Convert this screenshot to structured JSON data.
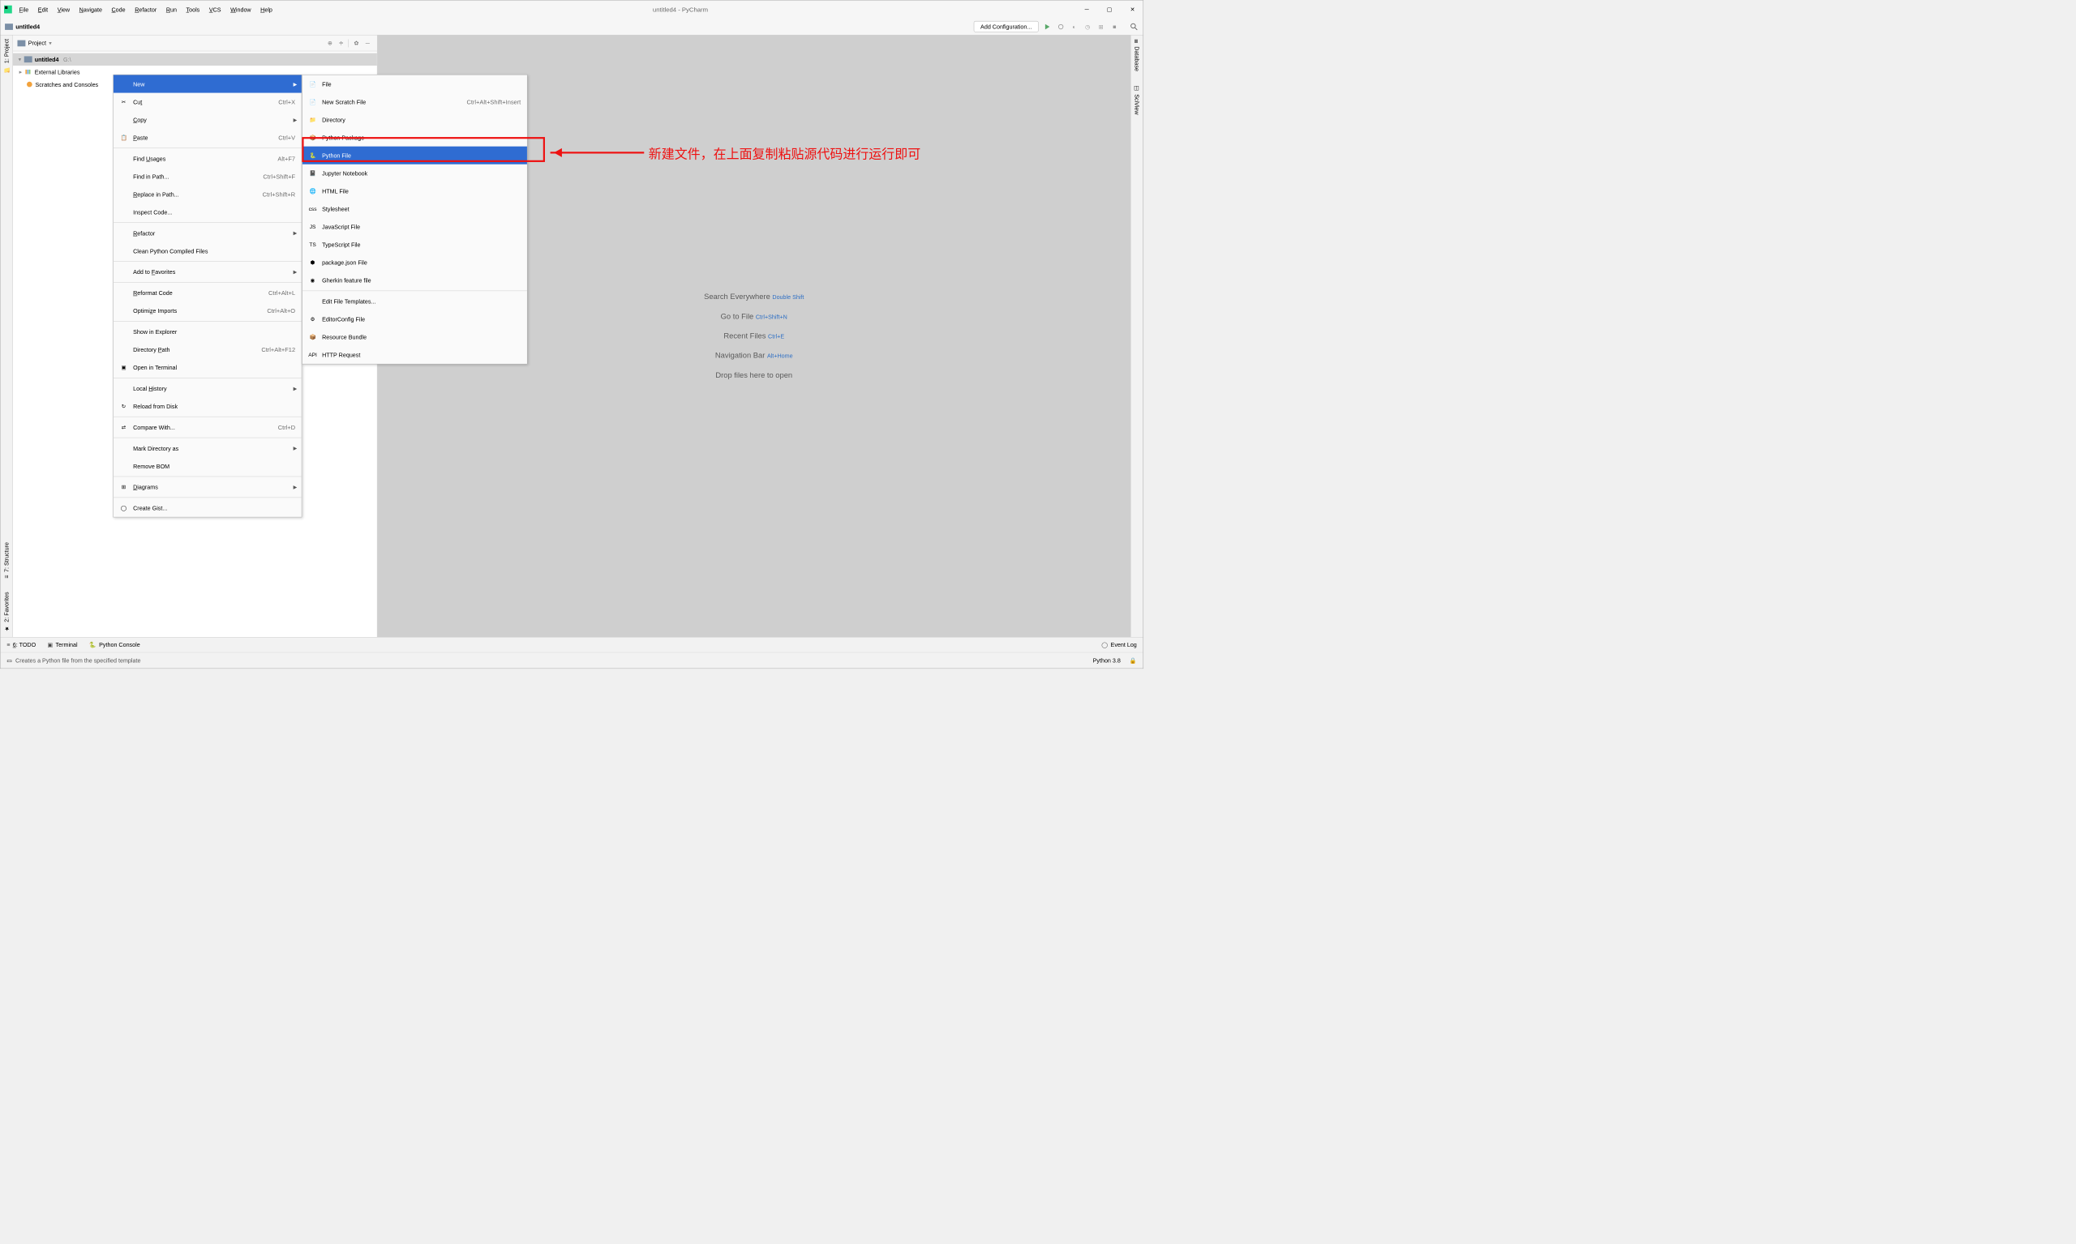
{
  "menubar": [
    "File",
    "Edit",
    "View",
    "Navigate",
    "Code",
    "Refactor",
    "Run",
    "Tools",
    "VCS",
    "Window",
    "Help"
  ],
  "window_title": "untitled4 - PyCharm",
  "crumb_project": "untitled4",
  "add_config": "Add Configuration...",
  "left_tabs": [
    "1: Project",
    "7: Structure",
    "2: Favorites"
  ],
  "right_tabs": [
    "Database",
    "SciView"
  ],
  "sidebar_title": "Project",
  "tree": {
    "root_name": "untitled4",
    "root_path": "G:\\",
    "libs": "External Libraries",
    "scratches": "Scratches and Consoles"
  },
  "hints": [
    {
      "t": "Search Everywhere ",
      "k": "Double Shift"
    },
    {
      "t": "Go to File ",
      "k": "Ctrl+Shift+N"
    },
    {
      "t": "Recent Files ",
      "k": "Ctrl+E"
    },
    {
      "t": "Navigation Bar ",
      "k": "Alt+Home"
    },
    {
      "t": "Drop files here to open",
      "k": ""
    }
  ],
  "ctx1": [
    {
      "type": "item",
      "label": "New",
      "sel": true,
      "arrow": true
    },
    {
      "type": "item",
      "icon": "✂",
      "label": "Cut",
      "u": "t",
      "sc": "Ctrl+X"
    },
    {
      "type": "item",
      "label": "Copy",
      "u": "C",
      "arrow": true
    },
    {
      "type": "item",
      "icon": "📋",
      "label": "Paste",
      "u": "P",
      "sc": "Ctrl+V"
    },
    {
      "type": "sep"
    },
    {
      "type": "item",
      "label": "Find Usages",
      "u": "U",
      "sc": "Alt+F7"
    },
    {
      "type": "item",
      "label": "Find in Path...",
      "sc": "Ctrl+Shift+F"
    },
    {
      "type": "item",
      "label": "Replace in Path...",
      "u": "R",
      "sc": "Ctrl+Shift+R"
    },
    {
      "type": "item",
      "label": "Inspect Code..."
    },
    {
      "type": "sep"
    },
    {
      "type": "item",
      "label": "Refactor",
      "u": "R",
      "arrow": true
    },
    {
      "type": "item",
      "label": "Clean Python Compiled Files"
    },
    {
      "type": "sep"
    },
    {
      "type": "item",
      "label": "Add to Favorites",
      "u": "F",
      "arrow": true
    },
    {
      "type": "sep"
    },
    {
      "type": "item",
      "label": "Reformat Code",
      "u": "R",
      "sc": "Ctrl+Alt+L"
    },
    {
      "type": "item",
      "label": "Optimize Imports",
      "u": "z",
      "sc": "Ctrl+Alt+O"
    },
    {
      "type": "sep"
    },
    {
      "type": "item",
      "label": "Show in Explorer"
    },
    {
      "type": "item",
      "label": "Directory Path",
      "u": "P",
      "sc": "Ctrl+Alt+F12"
    },
    {
      "type": "item",
      "icon": "▣",
      "label": "Open in Terminal"
    },
    {
      "type": "sep"
    },
    {
      "type": "item",
      "label": "Local History",
      "u": "H",
      "arrow": true
    },
    {
      "type": "item",
      "icon": "↻",
      "label": "Reload from Disk"
    },
    {
      "type": "sep"
    },
    {
      "type": "item",
      "icon": "⇄",
      "label": "Compare With...",
      "u": "",
      "sc": "Ctrl+D"
    },
    {
      "type": "sep"
    },
    {
      "type": "item",
      "label": "Mark Directory as",
      "arrow": true
    },
    {
      "type": "item",
      "label": "Remove BOM"
    },
    {
      "type": "sep"
    },
    {
      "type": "item",
      "icon": "⊞",
      "label": "Diagrams",
      "u": "D",
      "arrow": true
    },
    {
      "type": "sep"
    },
    {
      "type": "item",
      "icon": "◯",
      "label": "Create Gist..."
    }
  ],
  "ctx2": [
    {
      "icon": "📄",
      "label": "File"
    },
    {
      "icon": "📄",
      "label": "New Scratch File",
      "sc": "Ctrl+Alt+Shift+Insert"
    },
    {
      "icon": "📁",
      "label": "Directory"
    },
    {
      "icon": "📦",
      "label": "Python Package"
    },
    {
      "icon": "🐍",
      "label": "Python File",
      "sel": true
    },
    {
      "icon": "📓",
      "label": "Jupyter Notebook"
    },
    {
      "icon": "🌐",
      "label": "HTML File"
    },
    {
      "icon": "css",
      "label": "Stylesheet"
    },
    {
      "icon": "JS",
      "label": "JavaScript File"
    },
    {
      "icon": "TS",
      "label": "TypeScript File"
    },
    {
      "icon": "⬢",
      "label": "package.json File"
    },
    {
      "icon": "◉",
      "label": "Gherkin feature file"
    },
    {
      "type": "sep"
    },
    {
      "icon": "",
      "label": "Edit File Templates..."
    },
    {
      "icon": "⚙",
      "label": "EditorConfig File"
    },
    {
      "icon": "📦",
      "label": "Resource Bundle"
    },
    {
      "icon": "API",
      "label": "HTTP Request"
    }
  ],
  "annotation": "新建文件，在上面复制粘贴源代码进行运行即可",
  "bottom": {
    "todo": "6: TODO",
    "terminal": "Terminal",
    "pyconsole": "Python Console",
    "eventlog": "Event Log"
  },
  "status_msg": "Creates a Python file from the specified template",
  "status_right": "Python 3.8"
}
